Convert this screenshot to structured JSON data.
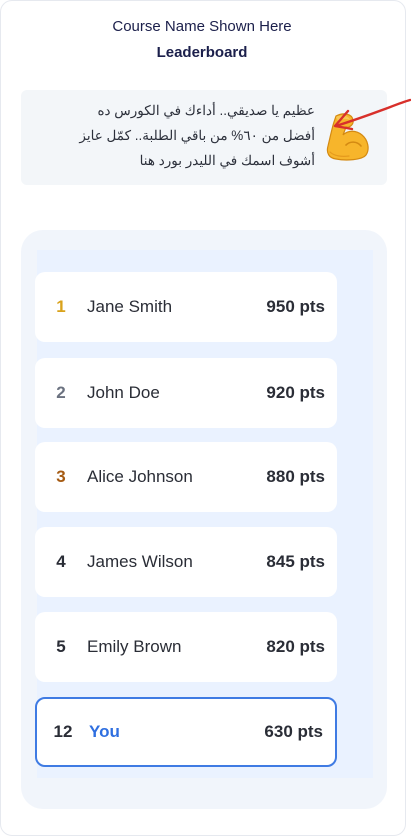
{
  "header": {
    "course_name": "Course Name Shown Here",
    "title": "Leaderboard"
  },
  "banner": {
    "lines": [
      "عظيم يا صديقي.. أداءك في الكورس ده",
      "أفضل من ٦٠% من باقي الطلبة.. كمّل عايز",
      "أشوف اسمك في الليدر بورد هنا"
    ],
    "emoji": "flexed-biceps-icon"
  },
  "leaderboard": {
    "rows": [
      {
        "rank": "1",
        "name": "Jane Smith",
        "points": "950 pts"
      },
      {
        "rank": "2",
        "name": "John Doe",
        "points": "920 pts"
      },
      {
        "rank": "3",
        "name": "Alice Johnson",
        "points": "880 pts"
      },
      {
        "rank": "4",
        "name": "James Wilson",
        "points": "845 pts"
      },
      {
        "rank": "5",
        "name": "Emily Brown",
        "points": "820 pts"
      },
      {
        "rank": "12",
        "name": "You",
        "points": "630 pts"
      }
    ]
  },
  "colors": {
    "accent": "#3f7be3",
    "gold": "#d9a21b",
    "bronze": "#a55a12",
    "arrow": "#d8302b"
  }
}
